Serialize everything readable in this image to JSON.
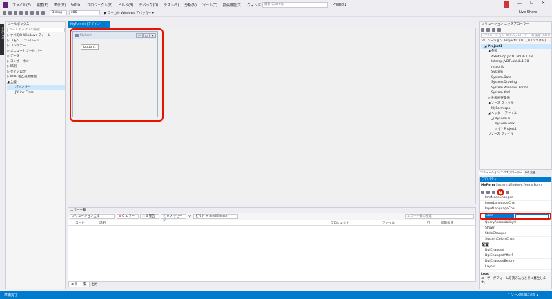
{
  "title": {
    "menus": [
      "ファイル(F)",
      "編集(E)",
      "表示(V)",
      "Git(G)",
      "プロジェクト(P)",
      "ビルド(B)",
      "デバッグ(D)",
      "テスト(S)",
      "分析(N)",
      "ツール(T)",
      "拡張機能(X)",
      "ウィンドウ(W)",
      "ヘルプ(H)"
    ],
    "search_placeholder": "検索 (Ctrl+Q)",
    "project": "Project1",
    "live_share": "Live Share"
  },
  "toolbar": {
    "config": "Debug",
    "platform": "x86",
    "run_label": "▶ ローカル Windows デバッガー ▾"
  },
  "vertical_tabs": [
    "ツールボックス",
    "チーム エクスプローラー"
  ],
  "toolbox": {
    "header": "ツールボックス",
    "search_placeholder": "ツールボックスの検索",
    "items": [
      "▷ すべての Windows フォーム",
      "▷ コモン コントロール",
      "▷ コンテナー",
      "▷ メニューとツール バー",
      "▷ データ",
      "▷ コンポーネント",
      "▷ 印刷",
      "▷ ダイアログ",
      "▷ WPF 相互運用機能",
      "◢ 全般",
      "ポインター",
      "JVLink Class"
    ]
  },
  "designer": {
    "tab": "MyForm.h [デザイン]",
    "form_title": "MyForm",
    "button_label": "button1"
  },
  "error_list": {
    "header": "エラー一覧",
    "scope": "ソリューション全体",
    "errors": "0 エラー",
    "warnings": "0 警告",
    "messages": "0 メッセージ",
    "build_filter": "ビルド + IntelliSense",
    "search_placeholder": "エラー一覧の検索",
    "columns": [
      "コード",
      "説明",
      "プロジェクト",
      "ファイル",
      "行",
      "抑制状態"
    ],
    "bottom_tabs": [
      "エラー一覧",
      "出力"
    ]
  },
  "solution": {
    "header": "ソリューション エクスプローラー",
    "search_placeholder": "ソリューション エクスプローラー の検索 (Ctrl+;)",
    "items": [
      {
        "label": "ソリューション 'Project1' (1/1 プロジェクト)",
        "indent": 0
      },
      {
        "label": "◢ Project1",
        "indent": 1
      },
      {
        "label": "◢ 参照",
        "indent": 2
      },
      {
        "label": "AxInterop.JVDTLabLib.1.18",
        "indent": 3
      },
      {
        "label": "Interop.JVDTLabLib.1.18",
        "indent": 3
      },
      {
        "label": "mscorlib",
        "indent": 3
      },
      {
        "label": "System",
        "indent": 3
      },
      {
        "label": "System.Data",
        "indent": 3
      },
      {
        "label": "System.Drawing",
        "indent": 3
      },
      {
        "label": "System.Windows.Forms",
        "indent": 3
      },
      {
        "label": "System.Xml",
        "indent": 3
      },
      {
        "label": "▷ 外部依存関係",
        "indent": 2
      },
      {
        "label": "◢ ソース ファイル",
        "indent": 2
      },
      {
        "label": "MyForm.cpp",
        "indent": 3
      },
      {
        "label": "◢ ヘッダー ファイル",
        "indent": 2
      },
      {
        "label": "◢ MyForm.h",
        "indent": 3
      },
      {
        "label": "MyForm.resx",
        "indent": 4
      },
      {
        "label": "▷ { } Project1",
        "indent": 4
      },
      {
        "label": "リソース ファイル",
        "indent": 2
      }
    ],
    "tabs": [
      "ソリューション エクスプローラー",
      "Git 変更"
    ]
  },
  "properties": {
    "header": "プロパティ",
    "object": "MyForm",
    "object_type": "System.Windows.Forms.Form",
    "rows": [
      "ImeModeChanged",
      "InputLanguageCha",
      "InputLanguageCha",
      "KeyDown",
      "KeyPress",
      "KeyUp",
      "Layout",
      "Load",
      "MaximizedBoundsChanged",
      "MaximumSizeChanged",
      "MinimumSizeChanged",
      "MouseCaptureChanged",
      "Move",
      "PaddingChanged",
      "QueryAccessibilityHelp",
      "Shown",
      "StyleChanged",
      "SystemColorsChanged",
      "Paint",
      "DpiChanged",
      "DpiChangedAfterP",
      "DpiChangedBefore",
      "Layout"
    ],
    "visible_rows": [
      "ImeModeChanged",
      "InputLanguageCha",
      "InputLanguageCha"
    ],
    "selected": "Load",
    "after_rows": [
      "QueryAccessibilityH",
      "Shown",
      "StyleChanged",
      "SystemColorsChan"
    ],
    "category": "配置",
    "category_rows": [
      "DpiChanged",
      "DpiChangedAfterP",
      "DpiChangedBefore",
      "Layout"
    ],
    "desc_title": "Load",
    "desc_text": "ユーザーがフォームを読み込むときに発生します。"
  },
  "status": {
    "ready": "準備完了",
    "source_control": "↑ ソース管理に追加 ▴"
  },
  "colors": {
    "accent": "#007acc",
    "highlight": "#e51400"
  }
}
